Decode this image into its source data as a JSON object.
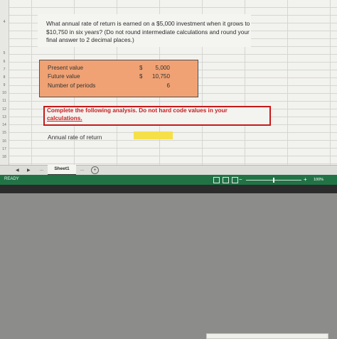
{
  "spreadsheet": {
    "row_numbers": [
      "4",
      "5",
      "6",
      "7",
      "8",
      "9",
      "10",
      "11",
      "12",
      "13",
      "14",
      "15",
      "16",
      "17",
      "18"
    ],
    "question": "What annual rate of return is earned on a $5,000 investment when it grows to $10,750 in six years? (Do not round intermediate calculations and round your final answer to 2 decimal places.)",
    "inputs": [
      {
        "label": "Present value",
        "currency": "$",
        "value": "5,000"
      },
      {
        "label": "Future value",
        "currency": "$",
        "value": "10,750"
      },
      {
        "label": "Number of periods",
        "currency": "",
        "value": "6"
      }
    ],
    "instruction_main": "Complete the following analysis. Do not hard code values in your ",
    "instruction_underlined": "calculations.",
    "answer_label": "Annual rate of return",
    "answer_value": "",
    "colors": {
      "input_fill": "#f0a274",
      "instruction_border": "#c61a1a",
      "answer_fill": "#f5e04a",
      "status_bar": "#217346"
    }
  },
  "tabbar": {
    "nav_prev": "◀",
    "nav_next": "▶",
    "more_left": "...",
    "sheet_tab": "Sheet1",
    "more_right": "...",
    "add_sheet": "+"
  },
  "statusbar": {
    "ready": "READY",
    "zoom_minus": "−",
    "zoom_plus": "+",
    "zoom_level": "100%",
    "zoom_value": 100
  }
}
